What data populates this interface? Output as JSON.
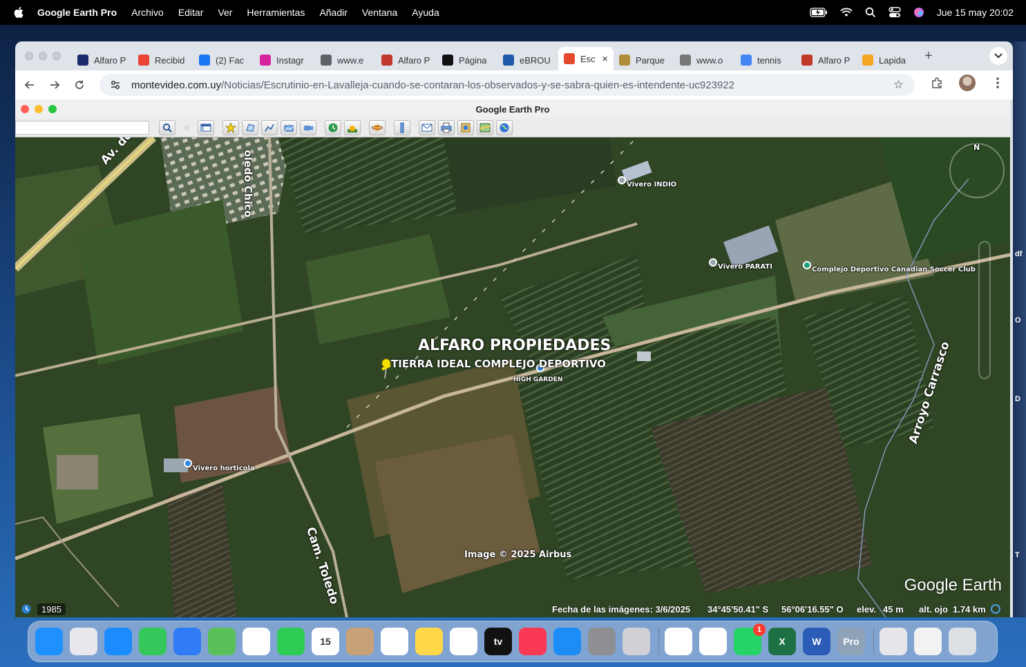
{
  "menubar": {
    "app_name": "Google Earth Pro",
    "items": [
      "Archivo",
      "Editar",
      "Ver",
      "Herramientas",
      "Añadir",
      "Ventana",
      "Ayuda"
    ],
    "datetime": "Jue 15 may 20:02"
  },
  "browser": {
    "tabs": [
      {
        "label": "Alfaro P",
        "color": "#1a2a6c"
      },
      {
        "label": "Recibid",
        "color": "#ea4335"
      },
      {
        "label": "(2) Fac",
        "color": "#1877f2"
      },
      {
        "label": "Instagr",
        "color": "#d6249f"
      },
      {
        "label": "www.e",
        "color": "#5f6368"
      },
      {
        "label": "Alfaro P",
        "color": "#c0392b"
      },
      {
        "label": "Página",
        "color": "#111111"
      },
      {
        "label": "eBROU",
        "color": "#1e5aa8"
      },
      {
        "label": "Esc",
        "color": "#e64a2e",
        "active": true
      },
      {
        "label": "Parque",
        "color": "#b08d3a"
      },
      {
        "label": "www.o",
        "color": "#777777"
      },
      {
        "label": "tennis",
        "color": "#4285f4"
      },
      {
        "label": "Alfaro P",
        "color": "#c0392b"
      },
      {
        "label": "Lapida",
        "color": "#f5a623"
      }
    ],
    "url_host": "montevideo.com.uy",
    "url_path": "/Noticias/Escrutinio-en-Lavalleja-cuando-se-contaran-los-observados-y-se-sabra-quien-es-intendente-uc923922"
  },
  "google_earth": {
    "window_title": "Google Earth Pro",
    "map_labels": {
      "road_av": "Av. de las",
      "road_toledo_chico": "oledo Chico",
      "road_cam_toledo": "Cam. Toledo",
      "arroyo": "Arroyo Carrasco",
      "vivero_indio": "Vivero INDIO",
      "vivero_parati": "Vivero PARATI",
      "complejo": "Complejo Deportivo Canadian Soccer Club",
      "vivero_horticola": "Vivero horticola",
      "high_garden": "HIGH GARDEN",
      "title": "ALFARO PROPIEDADES",
      "subtitle": "TIERRA IDEAL COMPLEJO DEPORTIVO",
      "copyright": "Image © 2025 Airbus",
      "compass_n": "N"
    },
    "status": {
      "year": "1985",
      "imagery_date": "Fecha de las imágenes: 3/6/2025",
      "lat": "34°45'50.41\" S",
      "lon": "56°06'16.55\" O",
      "elev_label": "elev.",
      "elev": "45 m",
      "eye_label": "alt. ojo",
      "eye": "1.74 km"
    },
    "logo": "Google Earth"
  },
  "edge_letters": [
    "df",
    "O",
    "D",
    "T"
  ],
  "dock": {
    "apps": [
      {
        "name": "finder",
        "color": "#1e90ff",
        "glyph": ""
      },
      {
        "name": "launchpad",
        "color": "#e8e8ee",
        "glyph": ""
      },
      {
        "name": "safari",
        "color": "#1a8cff",
        "glyph": ""
      },
      {
        "name": "messages",
        "color": "#34c759",
        "glyph": ""
      },
      {
        "name": "mail",
        "color": "#2f7cf6",
        "glyph": ""
      },
      {
        "name": "maps",
        "color": "#5ac05a",
        "glyph": ""
      },
      {
        "name": "photos",
        "color": "#ffffff",
        "glyph": ""
      },
      {
        "name": "facetime",
        "color": "#2ecc55",
        "glyph": ""
      },
      {
        "name": "calendar",
        "color": "#ffffff",
        "glyph": "15"
      },
      {
        "name": "contacts",
        "color": "#c9a177",
        "glyph": ""
      },
      {
        "name": "reminders",
        "color": "#ffffff",
        "glyph": ""
      },
      {
        "name": "notes",
        "color": "#ffd84a",
        "glyph": ""
      },
      {
        "name": "freeform",
        "color": "#ffffff",
        "glyph": ""
      },
      {
        "name": "tv",
        "color": "#111111",
        "glyph": "tv"
      },
      {
        "name": "music",
        "color": "#fa3a55",
        "glyph": ""
      },
      {
        "name": "app-store",
        "color": "#1c8cf7",
        "glyph": ""
      },
      {
        "name": "system-settings",
        "color": "#8e8e93",
        "glyph": ""
      },
      {
        "name": "iphone-mirroring",
        "color": "#d0d0d6",
        "glyph": ""
      }
    ],
    "apps2": [
      {
        "name": "maps-alt",
        "color": "#ffffff",
        "glyph": ""
      },
      {
        "name": "chrome",
        "color": "#ffffff",
        "glyph": ""
      },
      {
        "name": "whatsapp",
        "color": "#25d366",
        "glyph": "",
        "badge": "1"
      },
      {
        "name": "excel",
        "color": "#1d7044",
        "glyph": "X"
      },
      {
        "name": "word",
        "color": "#2b5cb8",
        "glyph": "W"
      },
      {
        "name": "google-earth-pro",
        "color": "#8fa3b8",
        "glyph": "Pro"
      }
    ],
    "apps3": [
      {
        "name": "preview-doc",
        "color": "#e6e6ea",
        "glyph": ""
      },
      {
        "name": "document",
        "color": "#f2f2f2",
        "glyph": ""
      },
      {
        "name": "trash",
        "color": "#dcdfe4",
        "glyph": ""
      }
    ]
  }
}
